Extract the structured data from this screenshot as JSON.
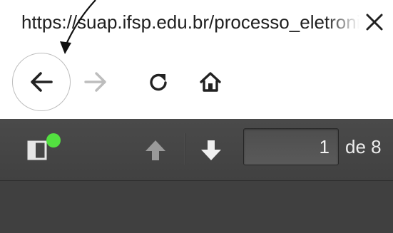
{
  "address_bar": {
    "url": "https://suap.ifsp.edu.br/processo_eletronico",
    "close_icon": "close-icon"
  },
  "navigation": {
    "back_icon": "arrow-left-icon",
    "forward_icon": "arrow-right-icon",
    "reload_icon": "reload-icon",
    "home_icon": "home-icon"
  },
  "pdf_toolbar": {
    "sidebar_icon": "sidebar-toggle-icon",
    "notification_color": "#53e040",
    "prev_icon": "arrow-up-icon",
    "next_icon": "arrow-down-icon",
    "page_value": "1",
    "page_count_text": "de 8"
  },
  "colors": {
    "toolbar_bg": "#464646",
    "viewer_bg": "#404040",
    "text_dark": "#202020",
    "text_light": "#ececec"
  }
}
